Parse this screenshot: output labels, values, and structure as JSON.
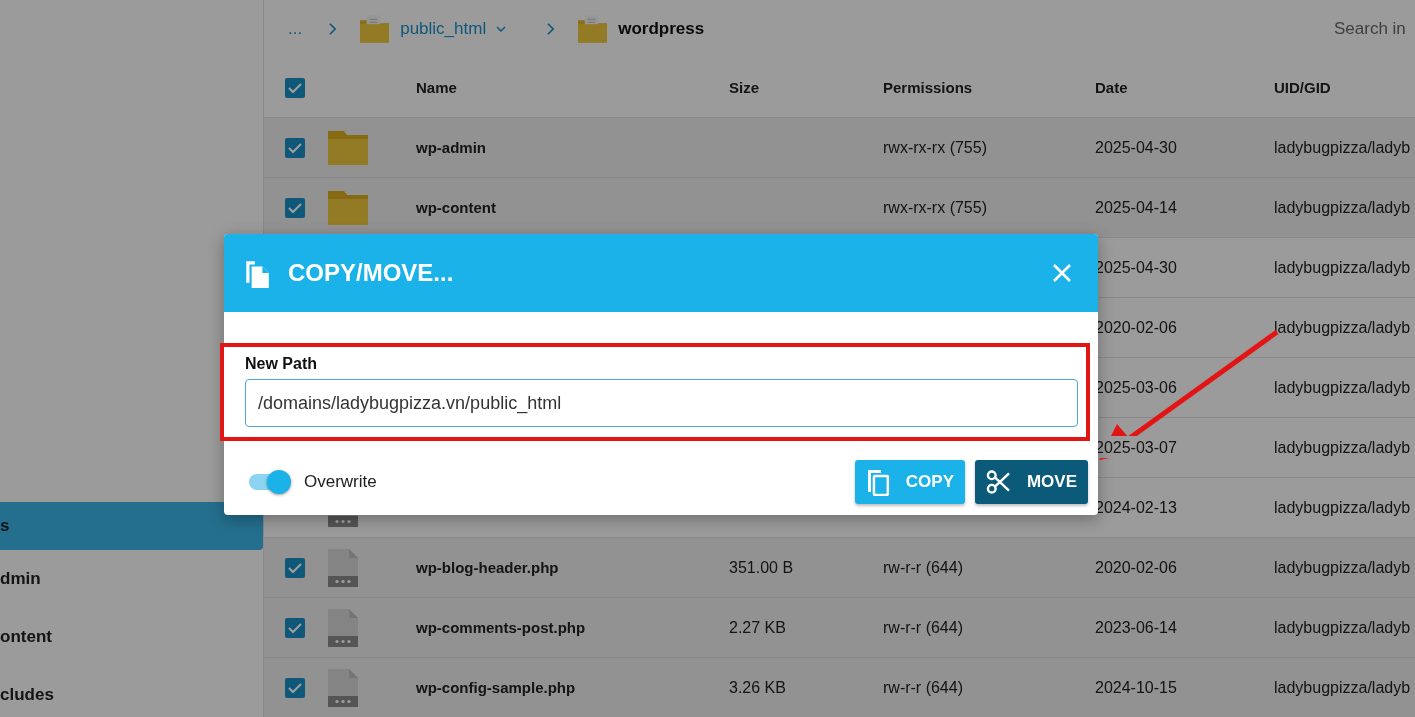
{
  "breadcrumb": [
    {
      "label": "...",
      "kind": "ellipsis"
    },
    {
      "label": "public_html",
      "kind": "folder",
      "dropdown": true
    },
    {
      "label": "wordpress",
      "kind": "current",
      "dropdown": false
    }
  ],
  "search": {
    "placeholder": "Search in"
  },
  "sidebar": {
    "items": [
      {
        "label": "s",
        "selected": true
      },
      {
        "label": "dmin",
        "selected": false
      },
      {
        "label": "ontent",
        "selected": false
      },
      {
        "label": "cludes",
        "selected": false
      }
    ]
  },
  "table": {
    "select_all": {
      "checked": true
    },
    "columns": [
      "Name",
      "Size",
      "Permissions",
      "Date",
      "UID/GID"
    ],
    "rows": [
      {
        "checked": true,
        "kind": "folder",
        "name": "wp-admin",
        "permissions": "rwx-rx-rx (755)",
        "date": "2025-04-30",
        "uid": "ladybugpizza/ladyb"
      },
      {
        "checked": true,
        "kind": "folder",
        "name": "wp-content",
        "permissions": "rwx-rx-rx (755)",
        "date": "2025-04-14",
        "uid": "ladybugpizza/ladyb"
      },
      {
        "date": "2025-04-30",
        "uid": "ladybugpizza/ladyb"
      },
      {
        "date": "2020-02-06",
        "uid": "ladybugpizza/ladyb"
      },
      {
        "date": "2025-03-06",
        "uid": "ladybugpizza/ladyb"
      },
      {
        "date": "2025-03-07",
        "uid": "ladybugpizza/ladyb"
      },
      {
        "kind": "file",
        "date": "2024-02-13",
        "uid": "ladybugpizza/ladyb"
      },
      {
        "checked": true,
        "kind": "file",
        "name": "wp-blog-header.php",
        "size": "351.00 B",
        "permissions": "rw-r-r (644)",
        "date": "2020-02-06",
        "uid": "ladybugpizza/ladyb"
      },
      {
        "checked": true,
        "kind": "file",
        "name": "wp-comments-post.php",
        "size": "2.27 KB",
        "permissions": "rw-r-r (644)",
        "date": "2023-06-14",
        "uid": "ladybugpizza/ladyb"
      },
      {
        "checked": true,
        "kind": "file",
        "name": "wp-config-sample.php",
        "size": "3.26 KB",
        "permissions": "rw-r-r (644)",
        "date": "2024-10-15",
        "uid": "ladybugpizza/ladyb"
      }
    ]
  },
  "dialog": {
    "title": "COPY/MOVE...",
    "field_label": "New Path",
    "field_value": "/domains/ladybugpizza.vn/public_html",
    "overwrite": {
      "label": "Overwrite",
      "on": true
    },
    "buttons": [
      {
        "label": "COPY",
        "kind": "copy"
      },
      {
        "label": "MOVE",
        "kind": "move"
      }
    ]
  }
}
